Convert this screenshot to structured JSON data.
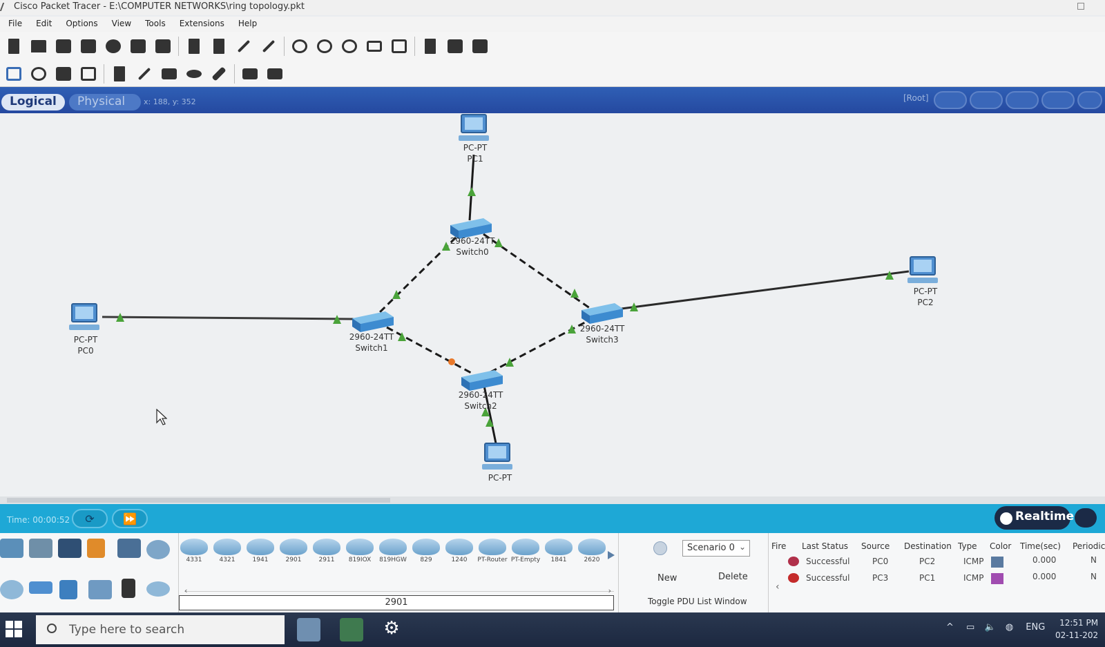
{
  "window": {
    "title": "Cisco Packet Tracer - E:\\COMPUTER NETWORKS\\ring topology.pkt"
  },
  "menu": [
    "File",
    "Edit",
    "Options",
    "View",
    "Tools",
    "Extensions",
    "Help"
  ],
  "workspace": {
    "logical_tab": "Logical",
    "physical_tab": "Physical",
    "cursor_coords": "x: 188, y: 352",
    "root_label": "[Root]"
  },
  "devices": [
    {
      "id": "pc1",
      "type": "pc",
      "line1": "PC-PT",
      "line2": "PC1"
    },
    {
      "id": "switch0",
      "type": "switch",
      "line1": "2960-24TT",
      "line2": "Switch0"
    },
    {
      "id": "pc0",
      "type": "pc",
      "line1": "PC-PT",
      "line2": "PC0"
    },
    {
      "id": "switch1",
      "type": "switch",
      "line1": "2960-24TT",
      "line2": "Switch1"
    },
    {
      "id": "switch2",
      "type": "switch",
      "line1": "2960-24TT",
      "line2": "Switch2"
    },
    {
      "id": "switch3",
      "type": "switch",
      "line1": "2960-24TT",
      "line2": "Switch3"
    },
    {
      "id": "pc2",
      "type": "pc",
      "line1": "PC-PT",
      "line2": "PC2"
    },
    {
      "id": "pc3",
      "type": "pc",
      "line1": "PC-PT",
      "line2": ""
    }
  ],
  "timebar": {
    "time": "Time: 00:00:52",
    "realtime_label": "Realtime"
  },
  "device_models": [
    "4331",
    "4321",
    "1941",
    "2901",
    "2911",
    "819IOX",
    "819HGW",
    "829",
    "1240",
    "PT-Router",
    "PT-Empty",
    "1841",
    "2620"
  ],
  "selected_model": "2901",
  "scenario": {
    "selected": "Scenario 0",
    "new_label": "New",
    "delete_label": "Delete",
    "toggle_label": "Toggle PDU List Window"
  },
  "pdu_table": {
    "columns": [
      "Fire",
      "Last Status",
      "Source",
      "Destination",
      "Type",
      "Color",
      "Time(sec)",
      "Periodic"
    ],
    "rows": [
      {
        "status": "Successful",
        "source": "PC0",
        "destination": "PC2",
        "type": "ICMP",
        "color": "#5a7aa0",
        "time": "0.000",
        "periodic": "N"
      },
      {
        "status": "Successful",
        "source": "PC3",
        "destination": "PC1",
        "type": "ICMP",
        "color": "#a04cb0",
        "time": "0.000",
        "periodic": "N"
      }
    ]
  },
  "taskbar": {
    "search_placeholder": "Type here to search",
    "language": "ENG",
    "time": "12:51 PM",
    "date": "02-11-202"
  }
}
